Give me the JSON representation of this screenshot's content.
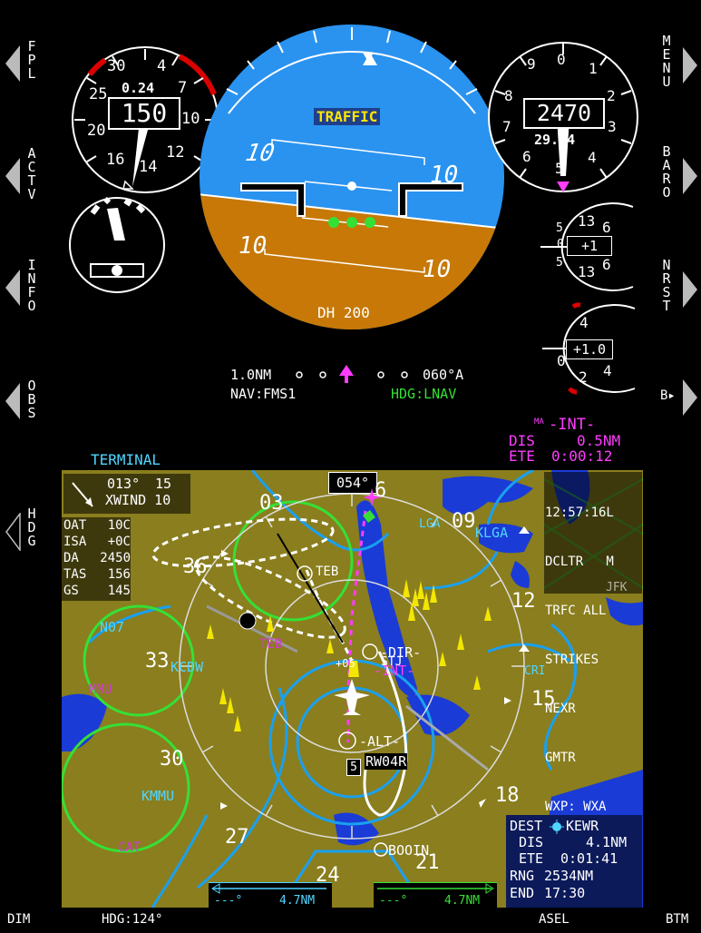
{
  "softkeys_left": [
    "FPL",
    "ACTV",
    "INFO",
    "OBS",
    "HDG"
  ],
  "softkeys_right": [
    "MENU",
    "BARO",
    "NRST",
    "B▸"
  ],
  "airspeed": {
    "mach": "0.24",
    "value": "150",
    "ticks": [
      "30",
      "4",
      "7",
      "25",
      "10",
      "20",
      "16",
      "14",
      "12"
    ]
  },
  "altimeter": {
    "value": "2470",
    "baro": "29.94",
    "ticks": [
      "9",
      "0",
      "1",
      "8",
      "2",
      "7",
      "3",
      "6",
      "5",
      "4"
    ]
  },
  "vsi": {
    "value": "+1",
    "ticks": [
      "5",
      "13",
      "6",
      "0",
      "5",
      "13",
      "6"
    ]
  },
  "gauge2": {
    "value": "+1.0",
    "ticks": [
      "4",
      "0",
      "2",
      "4"
    ]
  },
  "adi": {
    "traffic": "TRAFFIC",
    "dh": "DH 200",
    "pitch_labels": [
      "10",
      "10",
      "10",
      "10"
    ]
  },
  "nav_strip": {
    "range": "1.0NM",
    "course": "060°A",
    "nav_source": "NAV:FMS1",
    "hdg_mode": "HDG:LNAV"
  },
  "waypoint_info": {
    "ma": "MA",
    "name": "-INT-",
    "dis_label": "DIS",
    "dis": "0.5NM",
    "ete_label": "ETE",
    "ete": "0:00:12"
  },
  "map": {
    "terminal": "TERMINAL",
    "heading_box": "054°",
    "wind": {
      "dir": "013°",
      "speed": "15",
      "xwind": "XWIND 10"
    },
    "air_data": [
      [
        "OAT",
        "10C"
      ],
      [
        "ISA",
        "+0C"
      ],
      [
        "DA",
        "2450"
      ],
      [
        "TAS",
        "156"
      ],
      [
        "GS",
        "145"
      ]
    ],
    "top_right": [
      "12:57:16L",
      "DCLTR   M",
      "TRFC ALL",
      "STRIKES",
      "NEXR",
      "GMTR",
      "WXP: WXA"
    ],
    "compass": [
      "03",
      "6",
      "09",
      "12",
      "15",
      "18",
      "21",
      "24",
      "27",
      "30",
      "33",
      "36"
    ],
    "labels": {
      "teb": "TEB",
      "teb2": "TEB",
      "klga": "KLGA",
      "lga": "LGA",
      "n07": "N07",
      "kcdw": "KCDW",
      "mmu": "MMU",
      "kmmu": "KMMU",
      "cat": "CAT",
      "cri": "CRI",
      "dir": "-DIR-",
      "stj": "STJ",
      "int": "-INT-",
      "alt": "-ALT-",
      "rw04r": "RW04R",
      "booin": "BOOIN",
      "five": "5",
      "plus05": "+05",
      "jfk": "JFK"
    },
    "dest": {
      "label": "DEST",
      "ident": "KEWR",
      "dis_label": "DIS",
      "dis": "4.1NM",
      "ete_label": "ETE",
      "ete": "0:01:41",
      "rng_label": "RNG",
      "rng": "2534NM",
      "end_label": "END",
      "end": "17:30"
    },
    "bottom_left": {
      "deg": "---°",
      "dist": "4.7NM"
    },
    "bottom_right": {
      "deg": "---°",
      "dist": "4.7NM"
    }
  },
  "bottom_bar": {
    "dim": "DIM",
    "hdg": "HDG:124°",
    "asel": "ASEL",
    "btm": "BTM"
  },
  "colors": {
    "sky": "#2a93f0",
    "ground": "#c77806",
    "terrain": "#8a7e1e",
    "water": "#1a3bd6",
    "cyan": "#4fd6ff",
    "magenta": "#ff3cff",
    "green": "#35e035"
  }
}
